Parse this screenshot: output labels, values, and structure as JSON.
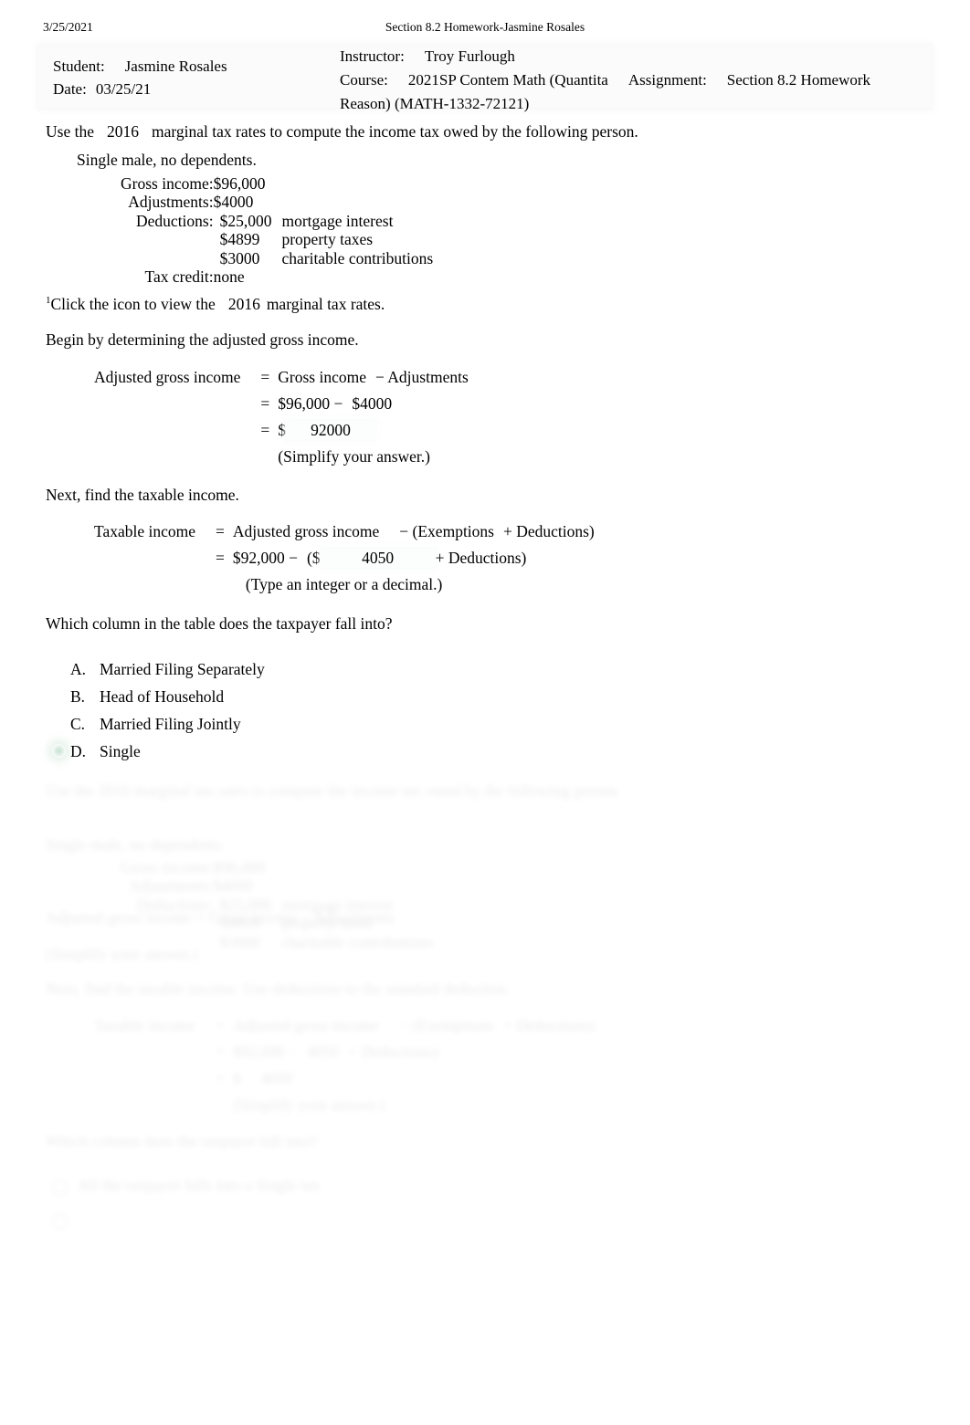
{
  "page": {
    "date": "3/25/2021",
    "doc_title": "Section 8.2 Homework-Jasmine Rosales"
  },
  "header": {
    "student_label": "Student:",
    "student_name": "Jasmine Rosales",
    "date_label": "Date:",
    "date_value": "03/25/21",
    "instructor_label": "Instructor:",
    "instructor_name": "Troy Furlough",
    "course_label": "Course:",
    "course_name_line1": "2021SP Contem Math (Quantita",
    "course_name_line2": "Reason) (MATH-1332-72121)",
    "assignment_label": "Assignment:",
    "assignment_name": "Section 8.2 Homework"
  },
  "problem": {
    "intro_a": "Use the",
    "intro_year": "2016",
    "intro_b": "marginal tax rates to compute the income tax owed by the following person.",
    "person": "Single male, no dependents.",
    "facts": [
      {
        "key": "Gross income:",
        "value": "$96,000",
        "note": ""
      },
      {
        "key": "Adjustments:",
        "value": "$4000",
        "note": ""
      },
      {
        "key": "Deductions:",
        "value": "$25,000",
        "note": "mortgage interest"
      },
      {
        "key": "",
        "value": "$4899",
        "note": "property taxes"
      },
      {
        "key": "",
        "value": "$3000",
        "note": "charitable contributions"
      },
      {
        "key": "Tax credit:",
        "value": "none",
        "note": ""
      }
    ],
    "footnote_marker": "1",
    "footnote_a": "Click the icon to view the",
    "footnote_year": "2016",
    "footnote_b": "marginal tax rates."
  },
  "agi": {
    "intro": "Begin by determining the adjusted gross income.",
    "row1_lhs": "Adjusted gross income",
    "row1_eq": "=",
    "row1_rhs": "Gross income",
    "row1_op": "− Adjustments",
    "row2_eq": "=",
    "row2_rhs": "$96,000 −",
    "row2_rhs2": "$4000",
    "row3_eq": "=",
    "row3_dollar": "$",
    "row3_answer": "92000",
    "hint": "(Simplify your answer.)"
  },
  "taxable": {
    "intro": "Next, find the taxable income.",
    "row1_lhs": "Taxable income",
    "row1_eq": "=",
    "row1_rhs": "Adjusted gross income",
    "row1_op": "− (Exemptions",
    "row1_op2": "+ Deductions)",
    "row2_eq": "=",
    "row2_rhs": "$92,000 −",
    "row2_open": "($",
    "row2_answer": "4050",
    "row2_tail": "+ Deductions)",
    "hint": "(Type an integer or a decimal.)"
  },
  "question": {
    "prompt": "Which column in the table does the taxpayer fall into?",
    "choices": [
      {
        "letter": "A.",
        "label": "Married Filing Separately",
        "selected": false
      },
      {
        "letter": "B.",
        "label": "Head of Household",
        "selected": false
      },
      {
        "letter": "C.",
        "label": "Married Filing Jointly",
        "selected": false
      },
      {
        "letter": "D.",
        "label": "Single",
        "selected": true
      }
    ]
  },
  "ghost": {
    "intro": "Use the 2016 marginal tax rates to compute the income tax owed by the following person.",
    "person": "Single male, no dependents.",
    "facts": [
      {
        "key": "Gross income:",
        "value": "$96,000",
        "note": ""
      },
      {
        "key": "Adjustments:",
        "value": "$4000",
        "note": ""
      },
      {
        "key": "Deductions:",
        "value": "$25,000",
        "note": "mortgage interest"
      },
      {
        "key": "",
        "value": "$4899",
        "note": "property taxes"
      },
      {
        "key": "",
        "value": "$3000",
        "note": "charitable contributions"
      },
      {
        "key": "Tax credit:",
        "value": "none",
        "note": ""
      }
    ],
    "agi_row1": "Adjusted gross income  =  Gross income  − Adjustments",
    "agi_row3": "(Simplify your answer.)",
    "taxable_intro": "Next, find the taxable income. Use deductions to the standard deduction.",
    "eq_lhs": "Taxable income",
    "eq_rhs": "Adjusted gross income",
    "eq_op": "− (Exemptions",
    "eq_op2": "+ Deductions)",
    "eq_row2a": "$92,000 −",
    "eq_row2b": "4050",
    "eq_row2c": "+ Deductions)",
    "eq_row3": "$",
    "eq_row3b": "4050",
    "eq_hint": "(Simplify your answer.)",
    "question": "Which column does the taxpayer fall into?",
    "choice": "All the taxpayer falls into a Single tax"
  },
  "colors": {
    "text": "#000000",
    "header_box_bg": "#fbfbfb",
    "selected_marker": "#96c8aa",
    "answer_field_bg": "#fcfdfd"
  }
}
